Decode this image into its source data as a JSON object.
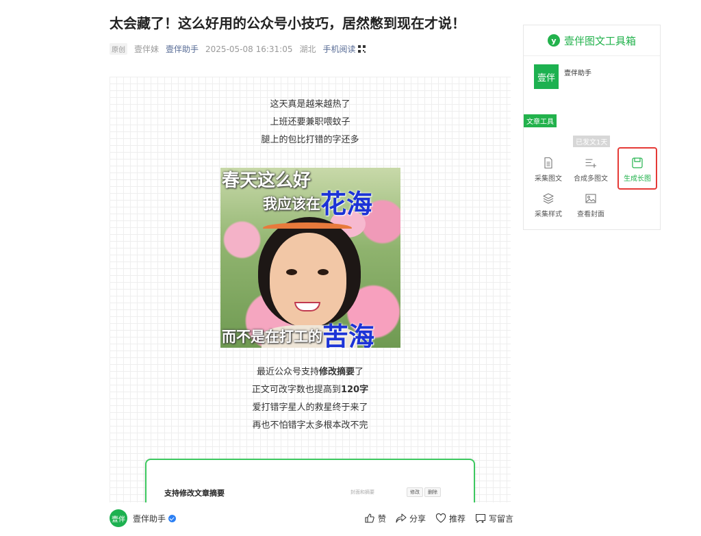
{
  "article": {
    "title": "太会藏了！这么好用的公众号小技巧，居然憋到现在才说！",
    "original_badge": "原创",
    "author": "壹伴妹",
    "account": "壹伴助手",
    "datetime": "2025-05-08 16:31:05",
    "location": "湖北",
    "mobile_read": "手机阅读"
  },
  "content": {
    "intro_lines": [
      "这天真是越来越热了",
      "上班还要兼职喂蚊子",
      "腿上的包比打错的字还多"
    ],
    "image_caption": {
      "line1": "春天这么好",
      "line2_prefix": "我应该在",
      "line2_big": "花海",
      "line3_prefix": "而不是在打工的",
      "line3_big": "苦海"
    },
    "para_lines": [
      {
        "before": "最近公众号支持",
        "bold": "修改摘要",
        "after": "了"
      },
      {
        "before": "正文可改字数也提高到",
        "bold": "120字",
        "after": ""
      },
      {
        "before": "爱打错字星人的救星终于来了",
        "bold": "",
        "after": ""
      },
      {
        "before": "再也不怕错字太多根本改不完",
        "bold": "",
        "after": ""
      }
    ],
    "card": {
      "title": "支持修改文章摘要",
      "hint": "封面和摘要",
      "btn_edit": "修改",
      "btn_delete": "删除"
    }
  },
  "bottom_bar": {
    "avatar_text": "壹伴",
    "account": "壹伴助手",
    "like": "赞",
    "share": "分享",
    "recommend": "推荐",
    "comment": "写留言"
  },
  "sidebar": {
    "title": "壹伴图文工具箱",
    "logo_letter": "y",
    "account_avatar": "壹伴",
    "account_name": "壹伴助手",
    "tools_tag": "文章工具",
    "sent_tag": "已发文1天",
    "tools": [
      {
        "label": "采集图文",
        "icon": "document-icon"
      },
      {
        "label": "合成多图文",
        "icon": "list-add-icon"
      },
      {
        "label": "生成长图",
        "icon": "save-image-icon",
        "active": true
      },
      {
        "label": "采集样式",
        "icon": "layers-icon"
      },
      {
        "label": "查看封面",
        "icon": "image-icon"
      }
    ],
    "accent_color": "#22b24c",
    "highlight_color": "#e53935"
  }
}
